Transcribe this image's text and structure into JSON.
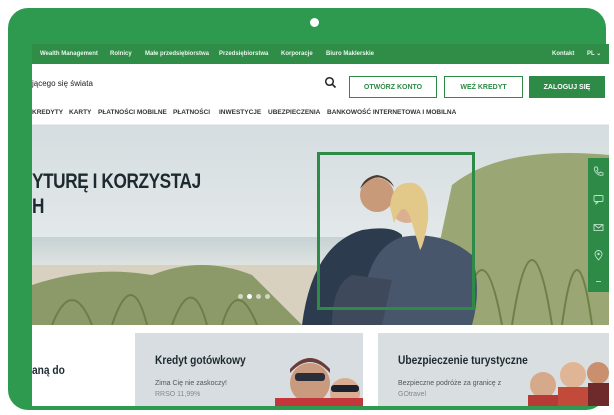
{
  "topbar": {
    "links": [
      "Wealth Management",
      "Rolnicy",
      "Małe przedsiębiorstwa",
      "Przedsiębiorstwa",
      "Korporacje",
      "Biuro Maklerskie"
    ],
    "contact": "Kontakt",
    "language": "PL"
  },
  "header": {
    "tagline": "jącego się świata",
    "open_account": "OTWÓRZ KONTO",
    "take_loan": "WEŹ KREDYT",
    "login": "ZALOGUJ SIĘ"
  },
  "nav": {
    "items": [
      "KREDYTY",
      "KARTY",
      "PŁATNOŚCI MOBILNE",
      "PŁATNOŚCI",
      "INWESTYCJE",
      "UBEZPIECZENIA",
      "BANKOWOŚĆ INTERNETOWA I MOBILNA"
    ]
  },
  "hero": {
    "title_line1": "YTURĘ I KORZYSTAJ",
    "title_line2": "H"
  },
  "cards": [
    {
      "title": "aną do",
      "text": "",
      "sub": ""
    },
    {
      "title": "Kredyt gotówkowy",
      "text": "Zima Cię nie zaskoczy!",
      "sub": "RRSO 11,99%"
    },
    {
      "title": "Ubezpieczenie turystyczne",
      "text": "Bezpieczne podróże za granicę z",
      "sub": "GOtravel"
    }
  ],
  "colors": {
    "device_frame": "#2e9a4f",
    "brand_green": "#2e8b47",
    "topbar": "#2f8d47"
  }
}
